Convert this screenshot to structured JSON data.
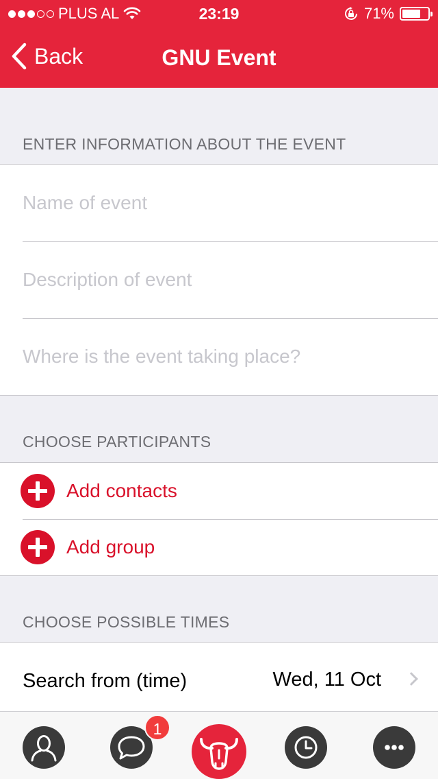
{
  "status_bar": {
    "carrier": "PLUS AL",
    "signal_dots_filled": 3,
    "signal_dots_total": 5,
    "time": "23:19",
    "battery_percent": "71%",
    "battery_level": 0.71
  },
  "nav": {
    "back_label": "Back",
    "title": "GNU Event"
  },
  "sections": {
    "info_header": "ENTER INFORMATION ABOUT THE EVENT",
    "participants_header": "CHOOSE PARTICIPANTS",
    "times_header": "CHOOSE POSSIBLE TIMES"
  },
  "fields": {
    "name_placeholder": "Name of event",
    "name_value": "",
    "description_placeholder": "Description of event",
    "description_value": "",
    "location_placeholder": "Where is the event taking place?",
    "location_value": ""
  },
  "participants": {
    "add_contacts_label": "Add contacts",
    "add_group_label": "Add group"
  },
  "times": {
    "search_from_label": "Search from (time)",
    "search_from_value": "Wed, 11 Oct"
  },
  "tabbar": {
    "chat_badge": "1",
    "icons": [
      "profile-icon",
      "chat-icon",
      "bull-logo-icon",
      "clock-icon",
      "more-icon"
    ]
  },
  "colors": {
    "accent": "#e5243b",
    "link_red": "#d9112a",
    "background": "#efeff4",
    "placeholder": "#c7c7cd"
  }
}
